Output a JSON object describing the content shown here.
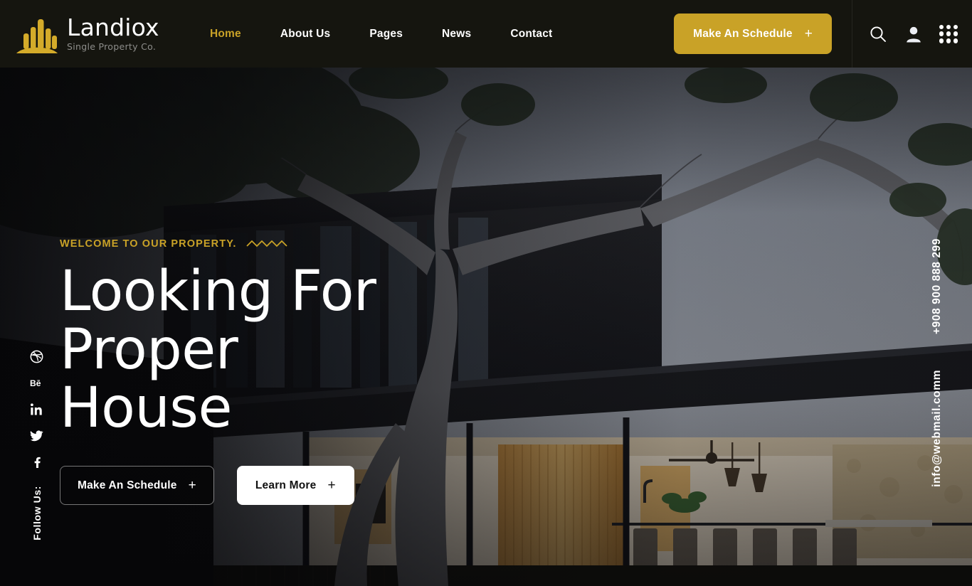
{
  "brand": {
    "name": "Landiox",
    "tagline": "Single Property Co.",
    "logo_icon": "building-bars-icon",
    "gold": "#c9a227",
    "header_bg": "#15150f"
  },
  "header": {
    "nav": [
      {
        "label": "Home",
        "active": true
      },
      {
        "label": "About Us",
        "active": false
      },
      {
        "label": "Pages",
        "active": false
      },
      {
        "label": "News",
        "active": false
      },
      {
        "label": "Contact",
        "active": false
      }
    ],
    "cta": {
      "label": "Make An Schedule",
      "plus": "+"
    },
    "icons": [
      {
        "name": "search-icon"
      },
      {
        "name": "user-account-icon"
      },
      {
        "name": "apps-grid-icon"
      }
    ]
  },
  "hero": {
    "eyebrow": "WELCOME TO OUR PROPERTY.",
    "eyebrow_decoration": "zigzag-icon",
    "title": "Looking For\nProper\nHouse",
    "primary_button": {
      "label": "Make An Schedule",
      "plus": "+"
    },
    "secondary_button": {
      "label": "Learn More",
      "plus": "+"
    },
    "background_description": "Modern dark-clad house at dusk with large eucalyptus tree and lit open-plan interior"
  },
  "social": {
    "label": "Follow Us:",
    "items": [
      {
        "name": "facebook-icon",
        "glyph": "f"
      },
      {
        "name": "twitter-icon",
        "glyph": "t"
      },
      {
        "name": "linkedin-icon",
        "glyph": "in"
      },
      {
        "name": "behance-icon",
        "glyph": "Bē"
      },
      {
        "name": "dribbble-icon",
        "glyph": "d"
      }
    ]
  },
  "contact": {
    "phone": "+908 900 888 299",
    "email": "info@webmail.comm"
  }
}
